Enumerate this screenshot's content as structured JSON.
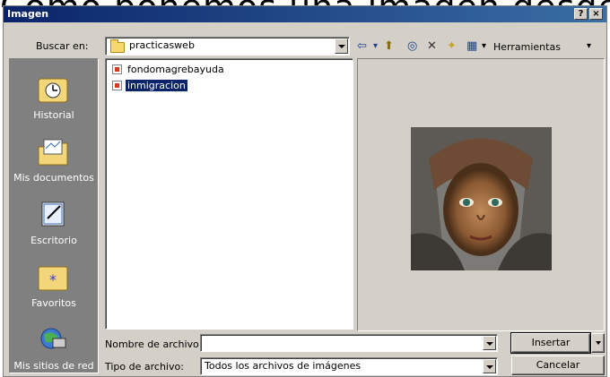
{
  "window": {
    "title": "Imagen",
    "help_btn": "?",
    "close_btn": "×"
  },
  "lookin": {
    "label": "Buscar en:",
    "value": "practicasweb"
  },
  "toolbar": {
    "back": "⇦",
    "dropdown_arrow": "▾",
    "up": "⬆",
    "search": "◎",
    "delete": "✕",
    "new_folder": "✦",
    "views": "▦",
    "tools_label": "Herramientas"
  },
  "places": [
    {
      "label": "Historial",
      "icon": "history-icon"
    },
    {
      "label": "Mis documentos",
      "icon": "my-documents-icon"
    },
    {
      "label": "Escritorio",
      "icon": "desktop-icon"
    },
    {
      "label": "Favoritos",
      "icon": "favorites-icon"
    },
    {
      "label": "Mis sitios de red",
      "icon": "network-places-icon"
    }
  ],
  "files": [
    {
      "name": "fondomagrebayuda",
      "selected": false
    },
    {
      "name": "inmigracion",
      "selected": true
    }
  ],
  "filename": {
    "label": "Nombre de archivo:",
    "value": ""
  },
  "filetype": {
    "label": "Tipo de archivo:",
    "value": "Todos los archivos de imágenes"
  },
  "buttons": {
    "insert": "Insertar",
    "cancel": "Cancelar"
  },
  "cropped_text": "Cómo ponemos  una imagen desde  el programa y  la carga"
}
